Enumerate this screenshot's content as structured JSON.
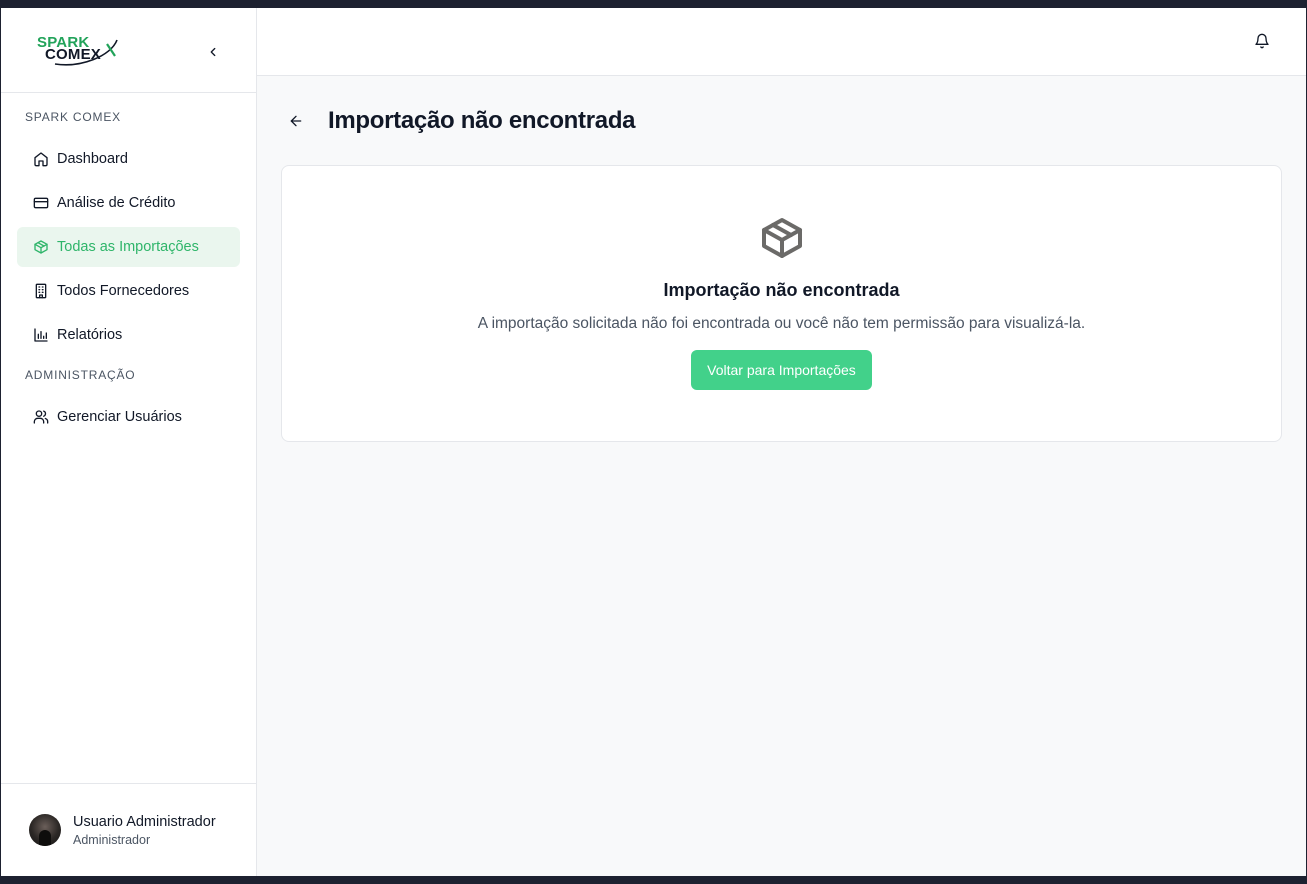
{
  "brand": {
    "logo_line1": "SPARK",
    "logo_line2": "COMEX",
    "accent_color": "#2fb56a"
  },
  "sidebar": {
    "sections": [
      {
        "label": "SPARK COMEX",
        "items": [
          {
            "label": "Dashboard",
            "icon": "home-icon",
            "active": false
          },
          {
            "label": "Análise de Crédito",
            "icon": "credit-card-icon",
            "active": false
          },
          {
            "label": "Todas as Importações",
            "icon": "package-icon",
            "active": true
          },
          {
            "label": "Todos Fornecedores",
            "icon": "building-icon",
            "active": false
          },
          {
            "label": "Relatórios",
            "icon": "bar-chart-icon",
            "active": false
          }
        ]
      },
      {
        "label": "ADMINISTRAÇÃO",
        "items": [
          {
            "label": "Gerenciar Usuários",
            "icon": "users-icon",
            "active": false
          }
        ]
      }
    ],
    "user": {
      "name": "Usuario Administrador",
      "role": "Administrador"
    }
  },
  "header": {
    "notification_icon": "bell-icon"
  },
  "page": {
    "title": "Importação não encontrada"
  },
  "empty_state": {
    "icon": "package-icon",
    "title": "Importação não encontrada",
    "description": "A importação solicitada não foi encontrada ou você não tem permissão para visualizá-la.",
    "button_label": "Voltar para Importações"
  }
}
